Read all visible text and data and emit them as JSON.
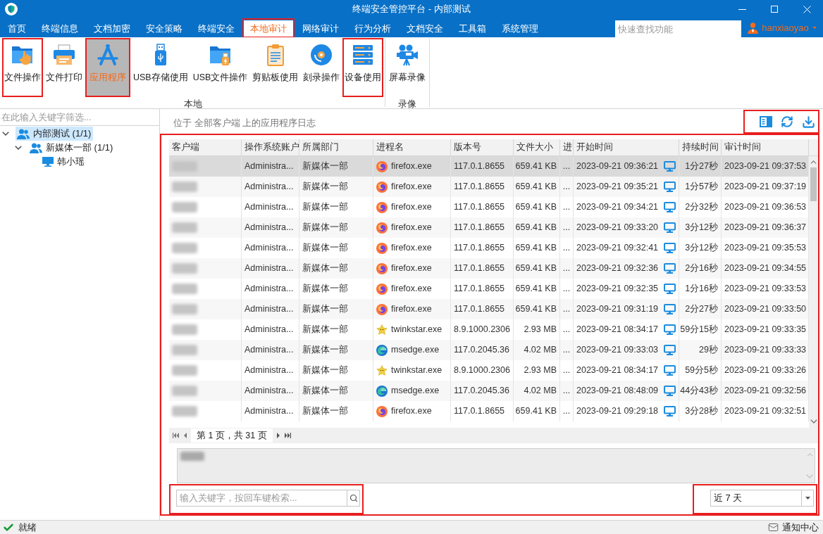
{
  "window": {
    "title": "终端安全管控平台 - 内部测试"
  },
  "menu": {
    "tabs": [
      {
        "label": "首页",
        "selected": false,
        "highlighted": false
      },
      {
        "label": "终端信息",
        "selected": false,
        "highlighted": false
      },
      {
        "label": "文档加密",
        "selected": false,
        "highlighted": false
      },
      {
        "label": "安全策略",
        "selected": false,
        "highlighted": false
      },
      {
        "label": "终端安全",
        "selected": false,
        "highlighted": false
      },
      {
        "label": "本地审计",
        "selected": true,
        "highlighted": true
      },
      {
        "label": "网络审计",
        "selected": false,
        "highlighted": false
      },
      {
        "label": "行为分析",
        "selected": false,
        "highlighted": false
      },
      {
        "label": "文档安全",
        "selected": false,
        "highlighted": false
      },
      {
        "label": "工具箱",
        "selected": false,
        "highlighted": false
      },
      {
        "label": "系统管理",
        "selected": false,
        "highlighted": false
      }
    ],
    "search": {
      "placeholder": "快速查找功能"
    },
    "user": {
      "name": "hanxiaoyao"
    }
  },
  "ribbon": {
    "groups": [
      {
        "label": "本地",
        "items": [
          {
            "label": "文件操作",
            "kind": "file_ops",
            "selected": false,
            "highlighted": true
          },
          {
            "label": "文件打印",
            "kind": "print",
            "selected": false,
            "highlighted": false
          },
          {
            "label": "应用程序",
            "kind": "app",
            "selected": true,
            "highlighted": true
          },
          {
            "label": "USB存储使用",
            "kind": "usb_storage",
            "selected": false,
            "highlighted": false
          },
          {
            "label": "USB文件操作",
            "kind": "usb_file",
            "selected": false,
            "highlighted": false
          },
          {
            "label": "剪贴板使用",
            "kind": "clipboard",
            "selected": false,
            "highlighted": false
          },
          {
            "label": "刻录操作",
            "kind": "burn",
            "selected": false,
            "highlighted": false
          },
          {
            "label": "设备使用",
            "kind": "device",
            "selected": false,
            "highlighted": true
          }
        ]
      },
      {
        "label": "录像",
        "items": [
          {
            "label": "屏幕录像",
            "kind": "screen_record",
            "selected": false,
            "highlighted": false
          }
        ]
      }
    ]
  },
  "sidebar": {
    "filter": {
      "placeholder": "在此输入关键字筛选..."
    },
    "tree": [
      {
        "label": "内部测试 (1/1)",
        "kind": "group",
        "selected": true,
        "expanded": true,
        "children": [
          {
            "label": "新媒体一部 (1/1)",
            "kind": "group",
            "selected": false,
            "expanded": true,
            "children": [
              {
                "label": "韩小瑶",
                "kind": "client",
                "selected": false
              }
            ]
          }
        ]
      }
    ]
  },
  "log_view": {
    "caption": "位于 全部客户端 上的应用程序日志",
    "toolbar": {
      "highlighted": true
    },
    "panel": {
      "highlighted": true,
      "table": {
        "columns": [
          "客户端",
          "操作系统账户",
          "所属部门",
          "进程名",
          "版本号",
          "文件大小",
          "进",
          "开始时间",
          "持续时间",
          "审计时间"
        ],
        "rows": [
          {
            "selected": true,
            "client_blurred": true,
            "os_account": "Administra...",
            "department": "新媒体一部",
            "process": {
              "name": "firefox.exe",
              "kind": "firefox"
            },
            "version": "117.0.1.8655",
            "file_size": "659.41 KB",
            "column_7": "...",
            "start_time": "2023-09-21 09:36:21",
            "duration": "1分27秒",
            "audit_time": "2023-09-21 09:37:53"
          },
          {
            "selected": false,
            "client_blurred": true,
            "os_account": "Administra...",
            "department": "新媒体一部",
            "process": {
              "name": "firefox.exe",
              "kind": "firefox"
            },
            "version": "117.0.1.8655",
            "file_size": "659.41 KB",
            "column_7": "...",
            "start_time": "2023-09-21 09:35:21",
            "duration": "1分57秒",
            "audit_time": "2023-09-21 09:37:19"
          },
          {
            "selected": false,
            "client_blurred": true,
            "os_account": "Administra...",
            "department": "新媒体一部",
            "process": {
              "name": "firefox.exe",
              "kind": "firefox"
            },
            "version": "117.0.1.8655",
            "file_size": "659.41 KB",
            "column_7": "...",
            "start_time": "2023-09-21 09:34:21",
            "duration": "2分32秒",
            "audit_time": "2023-09-21 09:36:53"
          },
          {
            "selected": false,
            "client_blurred": true,
            "os_account": "Administra...",
            "department": "新媒体一部",
            "process": {
              "name": "firefox.exe",
              "kind": "firefox"
            },
            "version": "117.0.1.8655",
            "file_size": "659.41 KB",
            "column_7": "...",
            "start_time": "2023-09-21 09:33:20",
            "duration": "3分12秒",
            "audit_time": "2023-09-21 09:36:37"
          },
          {
            "selected": false,
            "client_blurred": true,
            "os_account": "Administra...",
            "department": "新媒体一部",
            "process": {
              "name": "firefox.exe",
              "kind": "firefox"
            },
            "version": "117.0.1.8655",
            "file_size": "659.41 KB",
            "column_7": "...",
            "start_time": "2023-09-21 09:32:41",
            "duration": "3分12秒",
            "audit_time": "2023-09-21 09:35:53"
          },
          {
            "selected": false,
            "client_blurred": true,
            "os_account": "Administra...",
            "department": "新媒体一部",
            "process": {
              "name": "firefox.exe",
              "kind": "firefox"
            },
            "version": "117.0.1.8655",
            "file_size": "659.41 KB",
            "column_7": "...",
            "start_time": "2023-09-21 09:32:36",
            "duration": "2分16秒",
            "audit_time": "2023-09-21 09:34:55"
          },
          {
            "selected": false,
            "client_blurred": true,
            "os_account": "Administra...",
            "department": "新媒体一部",
            "process": {
              "name": "firefox.exe",
              "kind": "firefox"
            },
            "version": "117.0.1.8655",
            "file_size": "659.41 KB",
            "column_7": "...",
            "start_time": "2023-09-21 09:32:35",
            "duration": "1分16秒",
            "audit_time": "2023-09-21 09:33:53"
          },
          {
            "selected": false,
            "client_blurred": true,
            "os_account": "Administra...",
            "department": "新媒体一部",
            "process": {
              "name": "firefox.exe",
              "kind": "firefox"
            },
            "version": "117.0.1.8655",
            "file_size": "659.41 KB",
            "column_7": "...",
            "start_time": "2023-09-21 09:31:19",
            "duration": "2分27秒",
            "audit_time": "2023-09-21 09:33:50"
          },
          {
            "selected": false,
            "client_blurred": true,
            "os_account": "Administra...",
            "department": "新媒体一部",
            "process": {
              "name": "twinkstar.exe",
              "kind": "twinkstar"
            },
            "version": "8.9.1000.2306",
            "file_size": "2.93 MB",
            "column_7": "...",
            "start_time": "2023-09-21 08:34:17",
            "duration": "59分15秒",
            "audit_time": "2023-09-21 09:33:35"
          },
          {
            "selected": false,
            "client_blurred": true,
            "os_account": "Administra...",
            "department": "新媒体一部",
            "process": {
              "name": "msedge.exe",
              "kind": "edge"
            },
            "version": "117.0.2045.36",
            "file_size": "4.02 MB",
            "column_7": "...",
            "start_time": "2023-09-21 09:33:03",
            "duration": "29秒",
            "audit_time": "2023-09-21 09:33:33"
          },
          {
            "selected": false,
            "client_blurred": true,
            "os_account": "Administra...",
            "department": "新媒体一部",
            "process": {
              "name": "twinkstar.exe",
              "kind": "twinkstar"
            },
            "version": "8.9.1000.2306",
            "file_size": "2.93 MB",
            "column_7": "...",
            "start_time": "2023-09-21 08:34:17",
            "duration": "59分5秒",
            "audit_time": "2023-09-21 09:33:26"
          },
          {
            "selected": false,
            "client_blurred": true,
            "os_account": "Administra...",
            "department": "新媒体一部",
            "process": {
              "name": "msedge.exe",
              "kind": "edge"
            },
            "version": "117.0.2045.36",
            "file_size": "4.02 MB",
            "column_7": "...",
            "start_time": "2023-09-21 08:48:09",
            "duration": "44分43秒",
            "audit_time": "2023-09-21 09:32:56"
          },
          {
            "selected": false,
            "client_blurred": true,
            "os_account": "Administra...",
            "department": "新媒体一部",
            "process": {
              "name": "firefox.exe",
              "kind": "firefox"
            },
            "version": "117.0.1.8655",
            "file_size": "659.41 KB",
            "column_7": "...",
            "start_time": "2023-09-21 09:29:18",
            "duration": "3分28秒",
            "audit_time": "2023-09-21 09:32:51"
          }
        ]
      },
      "pagination": {
        "label": "第 1 页，共 31 页"
      },
      "detail": {
        "text_blurred": true
      },
      "search": {
        "placeholder": "输入关键字，按回车键检索...",
        "highlighted": true
      },
      "range_select": {
        "value": "近 7 天",
        "highlighted": true
      }
    }
  },
  "status_bar": {
    "status": "就绪",
    "notifications": "通知中心"
  }
}
